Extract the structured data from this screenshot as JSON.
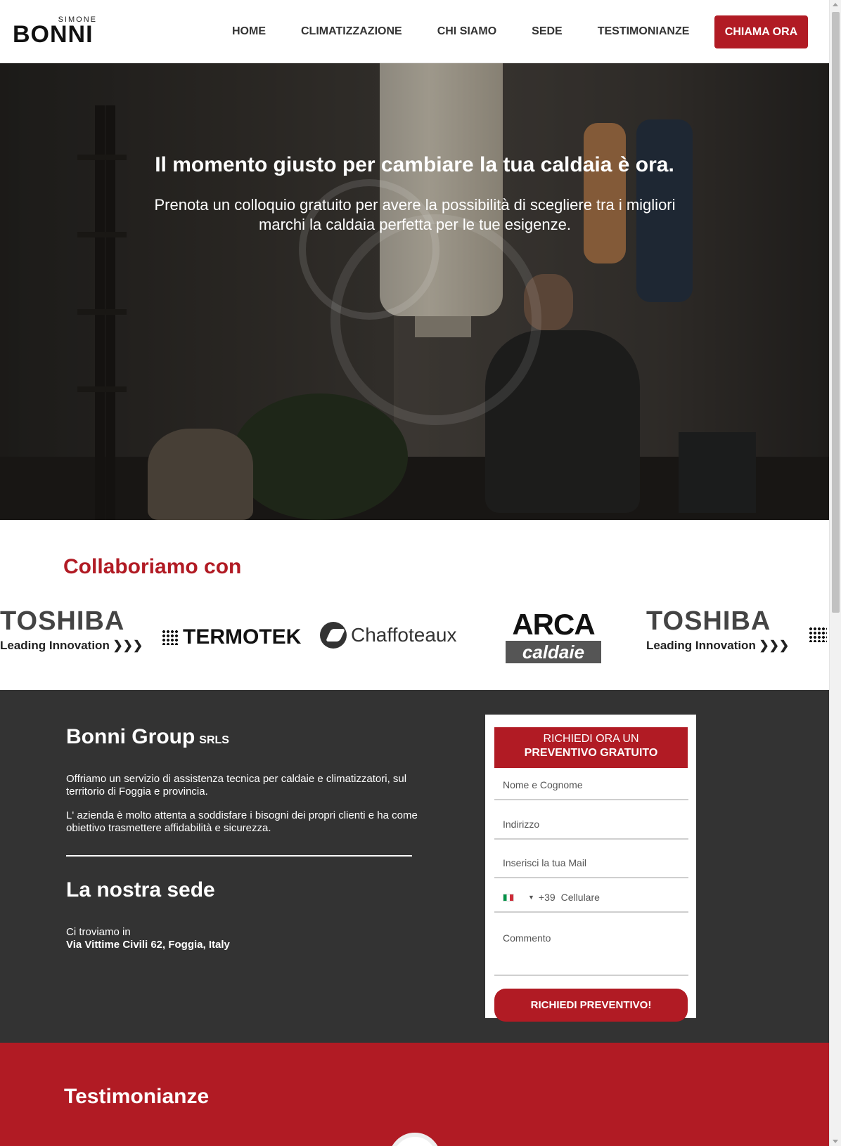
{
  "header": {
    "logo_top": "SIMONE",
    "logo_main": "BONNI",
    "nav": [
      "HOME",
      "CLIMATIZZAZIONE",
      "CHI SIAMO",
      "SEDE",
      "TESTIMONIANZE"
    ],
    "cta": "CHIAMA ORA"
  },
  "hero": {
    "title": "Il momento giusto per cambiare la tua caldaia è ora.",
    "subtitle": "Prenota un colloquio gratuito per avere la possibilità di scegliere tra i migliori marchi la caldaia perfetta per le tue esigenze."
  },
  "partners": {
    "title": "Collaboriamo con",
    "toshiba_name": "TOSHIBA",
    "toshiba_tag": "Leading Innovation ❯❯❯",
    "termotek": "TERMOTEK",
    "chaffoteaux": "Chaffoteaux",
    "arca_name": "ARCA",
    "arca_tag": "caldaie"
  },
  "info": {
    "company": "Bonni Group",
    "company_suffix": "SRLS",
    "p1": "Offriamo un servizio di assistenza tecnica per caldaie e climatizzatori, sul territorio di Foggia e provincia.",
    "p2": "L' azienda è molto attenta a soddisfare i bisogni dei propri clienti e ha come obiettivo trasmettere affidabilità e sicurezza.",
    "sede_title": "La nostra sede",
    "sede_lead": "Ci troviamo in",
    "sede_address": "Via Vittime Civili 62, Foggia, Italy"
  },
  "form": {
    "head_line1": "RICHIEDI ORA UN",
    "head_line2": "PREVENTIVO GRATUITO",
    "name_placeholder": "Nome e Cognome",
    "address_placeholder": "Indirizzo",
    "email_placeholder": "Inserisci la tua Mail",
    "phone_prefix": "+39",
    "phone_placeholder": "Cellulare",
    "comment_placeholder": "Commento",
    "submit": "RICHIEDI PREVENTIVO!"
  },
  "testimonials": {
    "title": "Testimonianze"
  },
  "colors": {
    "accent": "#b11b24",
    "dark_section": "#333333"
  }
}
